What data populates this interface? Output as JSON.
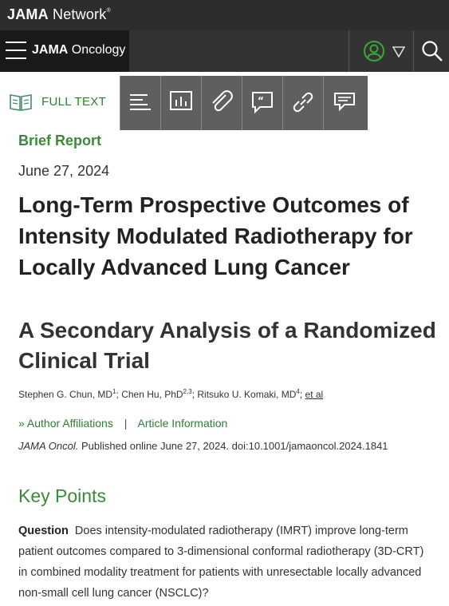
{
  "network": {
    "brand_bold": "JAMA",
    "brand_light": "Network",
    "mark": "®"
  },
  "journal": {
    "brand_bold": "JAMA",
    "brand_light": "Oncology"
  },
  "toolbar": {
    "full_text_label": "FULL TEXT"
  },
  "article": {
    "type": "Brief Report",
    "date": "June 27, 2024",
    "title": "Long-Term Prospective Outcomes of Intensity Modulated Radiotherapy for Locally Advanced Lung Cancer",
    "subtitle": "A Secondary Analysis of a Randomized Clinical Trial",
    "authors": [
      {
        "name": "Stephen G. Chun, MD",
        "sup": "1"
      },
      {
        "name": "Chen Hu, PhD",
        "sup": "2,3"
      },
      {
        "name": "Ritsuko U. Komaki, MD",
        "sup": "4"
      }
    ],
    "et_al": "et al",
    "author_affiliations": "Author Affiliations",
    "article_information": "Article Information",
    "separator": "|",
    "citation_journal": "JAMA Oncol.",
    "citation_rest": "Published online June 27, 2024. doi:10.1001/jamaoncol.2024.1841"
  },
  "key_points": {
    "heading": "Key Points",
    "question_label": "Question",
    "question_text": "Does intensity-modulated radiotherapy (IMRT) improve long-term patient outcomes compared to 3-dimensional conformal radiotherapy (3D-CRT) in combined modality treatment for patients with unresectable locally advanced non-small cell lung cancer (NSCLC)?"
  },
  "colors": {
    "accent_green": "#3a8a3a",
    "tool_gray": "#5f5f5f",
    "topbar": "#2d2d2d"
  },
  "icons": [
    "menu-icon",
    "user-icon",
    "chevron-down-icon",
    "search-icon",
    "book-icon",
    "outline-icon",
    "figures-icon",
    "attachment-icon",
    "comments-icon",
    "link-icon",
    "chat-icon"
  ]
}
